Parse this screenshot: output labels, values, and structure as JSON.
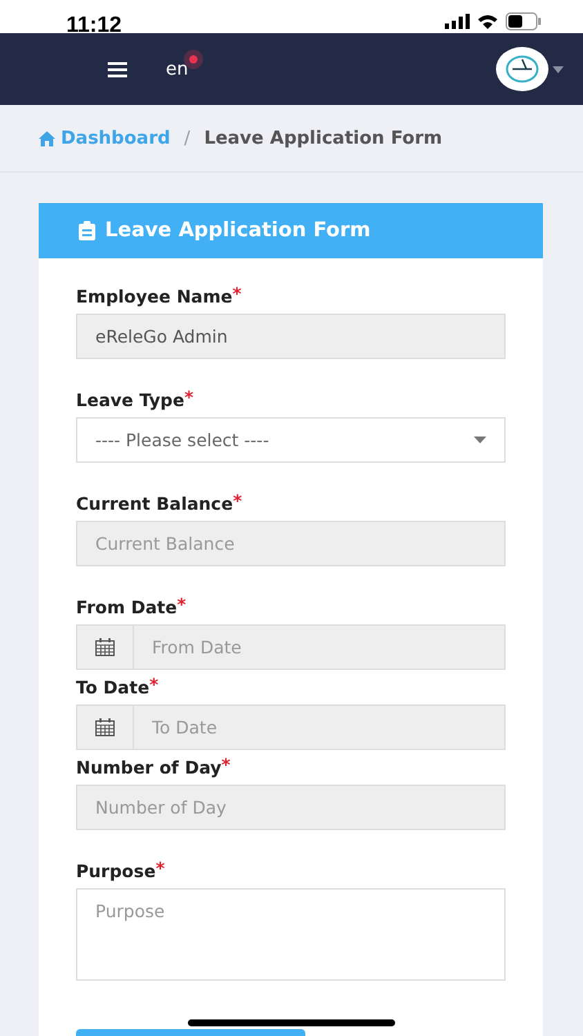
{
  "status_bar": {
    "time": "11:12"
  },
  "navbar": {
    "language": "en",
    "notification": true
  },
  "breadcrumb": {
    "items": [
      {
        "label": "Dashboard"
      },
      {
        "label": "Leave Application Form"
      }
    ],
    "separator": "/"
  },
  "form": {
    "title": "Leave Application Form",
    "fields": [
      {
        "kind": "text",
        "label": "Employee Name",
        "required_mark": "*",
        "value": "eReleGo Admin",
        "disabled": true
      },
      {
        "kind": "select",
        "label": "Leave Type",
        "required_mark": "*",
        "placeholder": "---- Please select ----",
        "disabled": false
      },
      {
        "kind": "text",
        "label": "Current Balance",
        "required_mark": "*",
        "placeholder": "Current Balance",
        "disabled": true
      },
      {
        "kind": "date",
        "label": "From Date",
        "required_mark": "*",
        "placeholder": "From Date",
        "disabled": true
      },
      {
        "kind": "date",
        "label": "To Date",
        "required_mark": "*",
        "placeholder": "To Date",
        "disabled": true
      },
      {
        "kind": "text",
        "label": "Number of Day",
        "required_mark": "*",
        "placeholder": "Number of Day",
        "disabled": true
      },
      {
        "kind": "textarea",
        "label": "Purpose",
        "required_mark": "*",
        "placeholder": "Purpose",
        "disabled": false
      }
    ]
  }
}
